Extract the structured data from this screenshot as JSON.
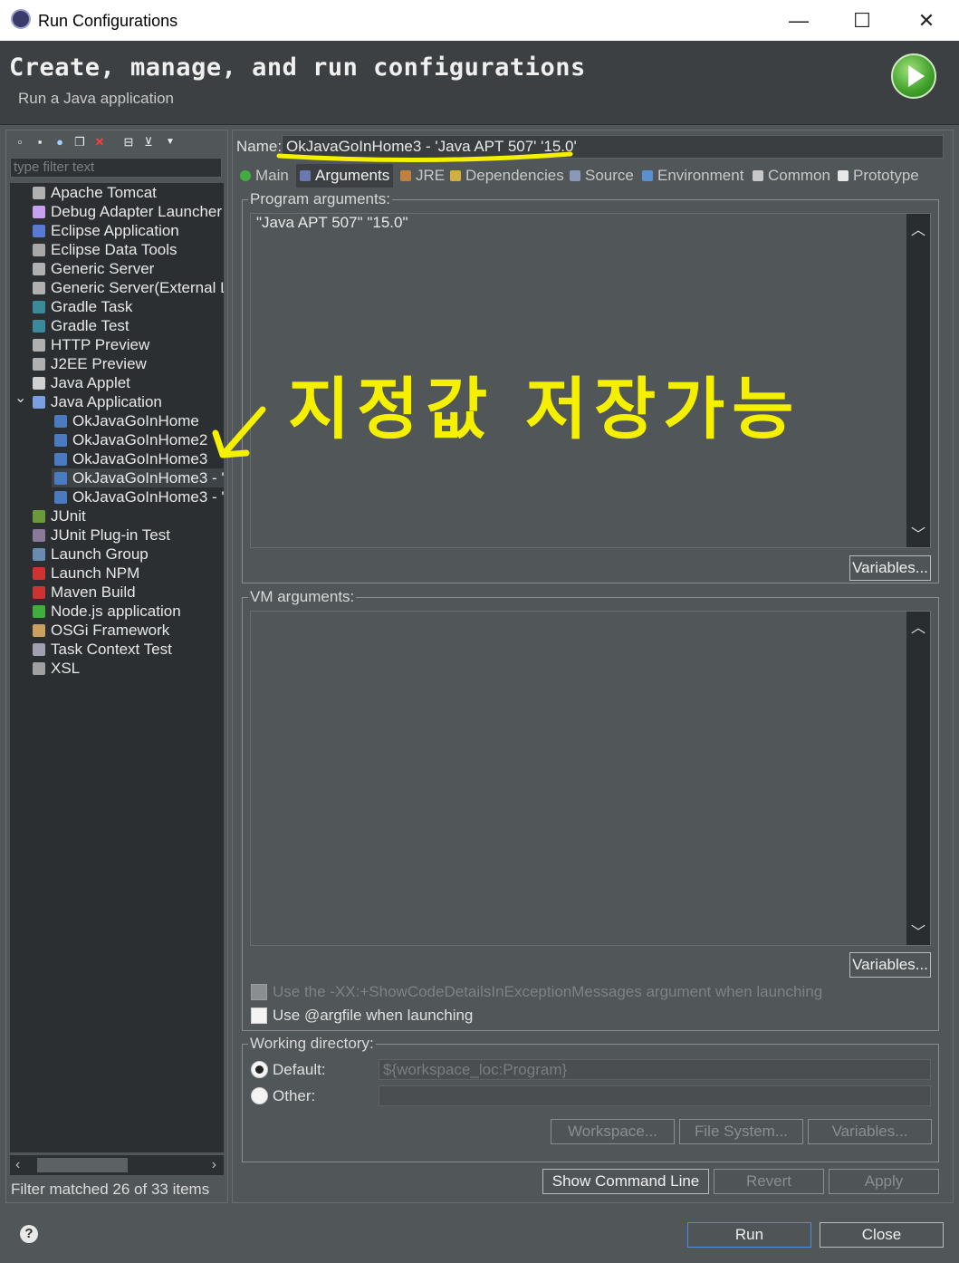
{
  "window": {
    "title": "Run Configurations",
    "minimize": "—",
    "maximize": "☐",
    "close": "✕"
  },
  "header": {
    "title": "Create, manage, and run configurations",
    "subtitle": "Run a Java application"
  },
  "left": {
    "filter_placeholder": "type filter text",
    "tree": [
      {
        "label": "Apache Tomcat",
        "level": 0
      },
      {
        "label": "Debug Adapter Launcher",
        "level": 0
      },
      {
        "label": "Eclipse Application",
        "level": 0
      },
      {
        "label": "Eclipse Data Tools",
        "level": 0
      },
      {
        "label": "Generic Server",
        "level": 0
      },
      {
        "label": "Generic Server(External L",
        "level": 0
      },
      {
        "label": "Gradle Task",
        "level": 0
      },
      {
        "label": "Gradle Test",
        "level": 0
      },
      {
        "label": "HTTP Preview",
        "level": 0
      },
      {
        "label": "J2EE Preview",
        "level": 0
      },
      {
        "label": "Java Applet",
        "level": 0
      },
      {
        "label": "Java Application",
        "level": 0,
        "expanded": true
      },
      {
        "label": "OkJavaGoInHome",
        "level": 1
      },
      {
        "label": "OkJavaGoInHome2",
        "level": 1
      },
      {
        "label": "OkJavaGoInHome3",
        "level": 1
      },
      {
        "label": "OkJavaGoInHome3 - '",
        "level": 1,
        "selected": true
      },
      {
        "label": "OkJavaGoInHome3 - '",
        "level": 1
      },
      {
        "label": "JUnit",
        "level": 0
      },
      {
        "label": "JUnit Plug-in Test",
        "level": 0
      },
      {
        "label": "Launch Group",
        "level": 0
      },
      {
        "label": "Launch NPM",
        "level": 0
      },
      {
        "label": "Maven Build",
        "level": 0
      },
      {
        "label": "Node.js application",
        "level": 0
      },
      {
        "label": "OSGi Framework",
        "level": 0
      },
      {
        "label": "Task Context Test",
        "level": 0
      },
      {
        "label": "XSL",
        "level": 0
      }
    ],
    "status": "Filter matched 26 of 33 items"
  },
  "right": {
    "name_label": "Name:",
    "name_value": "OkJavaGoInHome3 - 'Java APT 507' '15.0'",
    "tabs": [
      "Main",
      "Arguments",
      "JRE",
      "Dependencies",
      "Source",
      "Environment",
      "Common",
      "Prototype"
    ],
    "active_tab": "Arguments",
    "program_args_label": "Program arguments:",
    "program_args_value": "\"Java APT 507\" \"15.0\"",
    "variables_label": "Variables...",
    "vm_args_label": "VM arguments:",
    "vm_args_value": "",
    "show_code_details_label": "Use the -XX:+ShowCodeDetailsInExceptionMessages argument when launching",
    "argfile_label": "Use @argfile when launching",
    "working_dir_label": "Working directory:",
    "default_label": "Default:",
    "default_value": "${workspace_loc:Program}",
    "other_label": "Other:",
    "other_value": "",
    "workspace_btn": "Workspace...",
    "filesystem_btn": "File System...",
    "variables_btn": "Variables...",
    "show_cmd_btn": "Show Command Line",
    "revert_btn": "Revert",
    "apply_btn": "Apply"
  },
  "footer": {
    "run_btn": "Run",
    "close_btn": "Close",
    "help": "?"
  },
  "annotation": {
    "text": "지정값  저장가능",
    "color": "#f5f000"
  }
}
